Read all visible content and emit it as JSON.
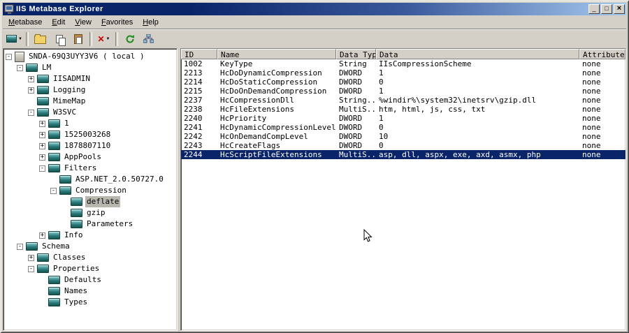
{
  "window": {
    "title": "IIS Metabase Explorer"
  },
  "window_controls": {
    "minimize": "_",
    "maximize": "□",
    "close": "×"
  },
  "menu": {
    "items": [
      "Metabase",
      "Edit",
      "View",
      "Favorites",
      "Help"
    ]
  },
  "toolbar": {
    "dropdown_glyph": "▼",
    "delete_glyph": "✕",
    "buttons": [
      "new-key-dropdown",
      "open-folder",
      "copy",
      "paste",
      "delete-dropdown",
      "refresh",
      "connect-network"
    ]
  },
  "tree": {
    "items": [
      {
        "label": "SNDA-69Q3UYY3V6 ( local )",
        "depth": 0,
        "expander": "-",
        "icon": "server",
        "selected": false
      },
      {
        "label": "LM",
        "depth": 1,
        "expander": "-",
        "icon": "key",
        "selected": false
      },
      {
        "label": "IISADMIN",
        "depth": 2,
        "expander": "+",
        "icon": "key",
        "selected": false
      },
      {
        "label": "Logging",
        "depth": 2,
        "expander": "+",
        "icon": "key",
        "selected": false
      },
      {
        "label": "MimeMap",
        "depth": 2,
        "expander": "",
        "icon": "key",
        "selected": false
      },
      {
        "label": "W3SVC",
        "depth": 2,
        "expander": "-",
        "icon": "key",
        "selected": false
      },
      {
        "label": "1",
        "depth": 3,
        "expander": "+",
        "icon": "key",
        "selected": false
      },
      {
        "label": "1525003268",
        "depth": 3,
        "expander": "+",
        "icon": "key",
        "selected": false
      },
      {
        "label": "1878807110",
        "depth": 3,
        "expander": "+",
        "icon": "key",
        "selected": false
      },
      {
        "label": "AppPools",
        "depth": 3,
        "expander": "+",
        "icon": "key",
        "selected": false
      },
      {
        "label": "Filters",
        "depth": 3,
        "expander": "-",
        "icon": "key",
        "selected": false
      },
      {
        "label": "ASP.NET_2.0.50727.0",
        "depth": 4,
        "expander": "",
        "icon": "key",
        "selected": false
      },
      {
        "label": "Compression",
        "depth": 4,
        "expander": "-",
        "icon": "key",
        "selected": false
      },
      {
        "label": "deflate",
        "depth": 5,
        "expander": "",
        "icon": "key",
        "selected": true
      },
      {
        "label": "gzip",
        "depth": 5,
        "expander": "",
        "icon": "key",
        "selected": false
      },
      {
        "label": "Parameters",
        "depth": 5,
        "expander": "",
        "icon": "key",
        "selected": false
      },
      {
        "label": "Info",
        "depth": 3,
        "expander": "+",
        "icon": "key",
        "selected": false
      },
      {
        "label": "Schema",
        "depth": 1,
        "expander": "-",
        "icon": "key",
        "selected": false
      },
      {
        "label": "Classes",
        "depth": 2,
        "expander": "+",
        "icon": "key",
        "selected": false
      },
      {
        "label": "Properties",
        "depth": 2,
        "expander": "-",
        "icon": "key",
        "selected": false
      },
      {
        "label": "Defaults",
        "depth": 3,
        "expander": "",
        "icon": "key",
        "selected": false
      },
      {
        "label": "Names",
        "depth": 3,
        "expander": "",
        "icon": "key",
        "selected": false
      },
      {
        "label": "Types",
        "depth": 3,
        "expander": "",
        "icon": "key",
        "selected": false
      }
    ]
  },
  "table": {
    "columns": [
      "ID",
      "Name",
      "Data Type",
      "Data",
      "Attributes"
    ],
    "rows": [
      {
        "id": "1002",
        "name": "KeyType",
        "type": "String",
        "data": "IIsCompressionScheme",
        "attr": "none",
        "selected": false
      },
      {
        "id": "2213",
        "name": "HcDoDynamicCompression",
        "type": "DWORD",
        "data": "1",
        "attr": "none",
        "selected": false
      },
      {
        "id": "2214",
        "name": "HcDoStaticCompression",
        "type": "DWORD",
        "data": "0",
        "attr": "none",
        "selected": false
      },
      {
        "id": "2215",
        "name": "HcDoOnDemandCompression",
        "type": "DWORD",
        "data": "1",
        "attr": "none",
        "selected": false
      },
      {
        "id": "2237",
        "name": "HcCompressionDll",
        "type": "String...",
        "data": "%windir%\\system32\\inetsrv\\gzip.dll",
        "attr": "none",
        "selected": false
      },
      {
        "id": "2238",
        "name": "HcFileExtensions",
        "type": "MultiS...",
        "data": "htm, html, js, css, txt",
        "attr": "none",
        "selected": false
      },
      {
        "id": "2240",
        "name": "HcPriority",
        "type": "DWORD",
        "data": "1",
        "attr": "none",
        "selected": false
      },
      {
        "id": "2241",
        "name": "HcDynamicCompressionLevel",
        "type": "DWORD",
        "data": "0",
        "attr": "none",
        "selected": false
      },
      {
        "id": "2242",
        "name": "HcOnDemandCompLevel",
        "type": "DWORD",
        "data": "10",
        "attr": "none",
        "selected": false
      },
      {
        "id": "2243",
        "name": "HcCreateFlags",
        "type": "DWORD",
        "data": "0",
        "attr": "none",
        "selected": false
      },
      {
        "id": "2244",
        "name": "HcScriptFileExtensions",
        "type": "MultiS...",
        "data": "asp, dll, aspx, exe, axd, asmx, php",
        "attr": "none",
        "selected": true
      }
    ]
  },
  "colors": {
    "titlebar_left": "#0a246a",
    "titlebar_right": "#a6caf0",
    "selection": "#0a246a",
    "chrome": "#d4d0c8"
  }
}
